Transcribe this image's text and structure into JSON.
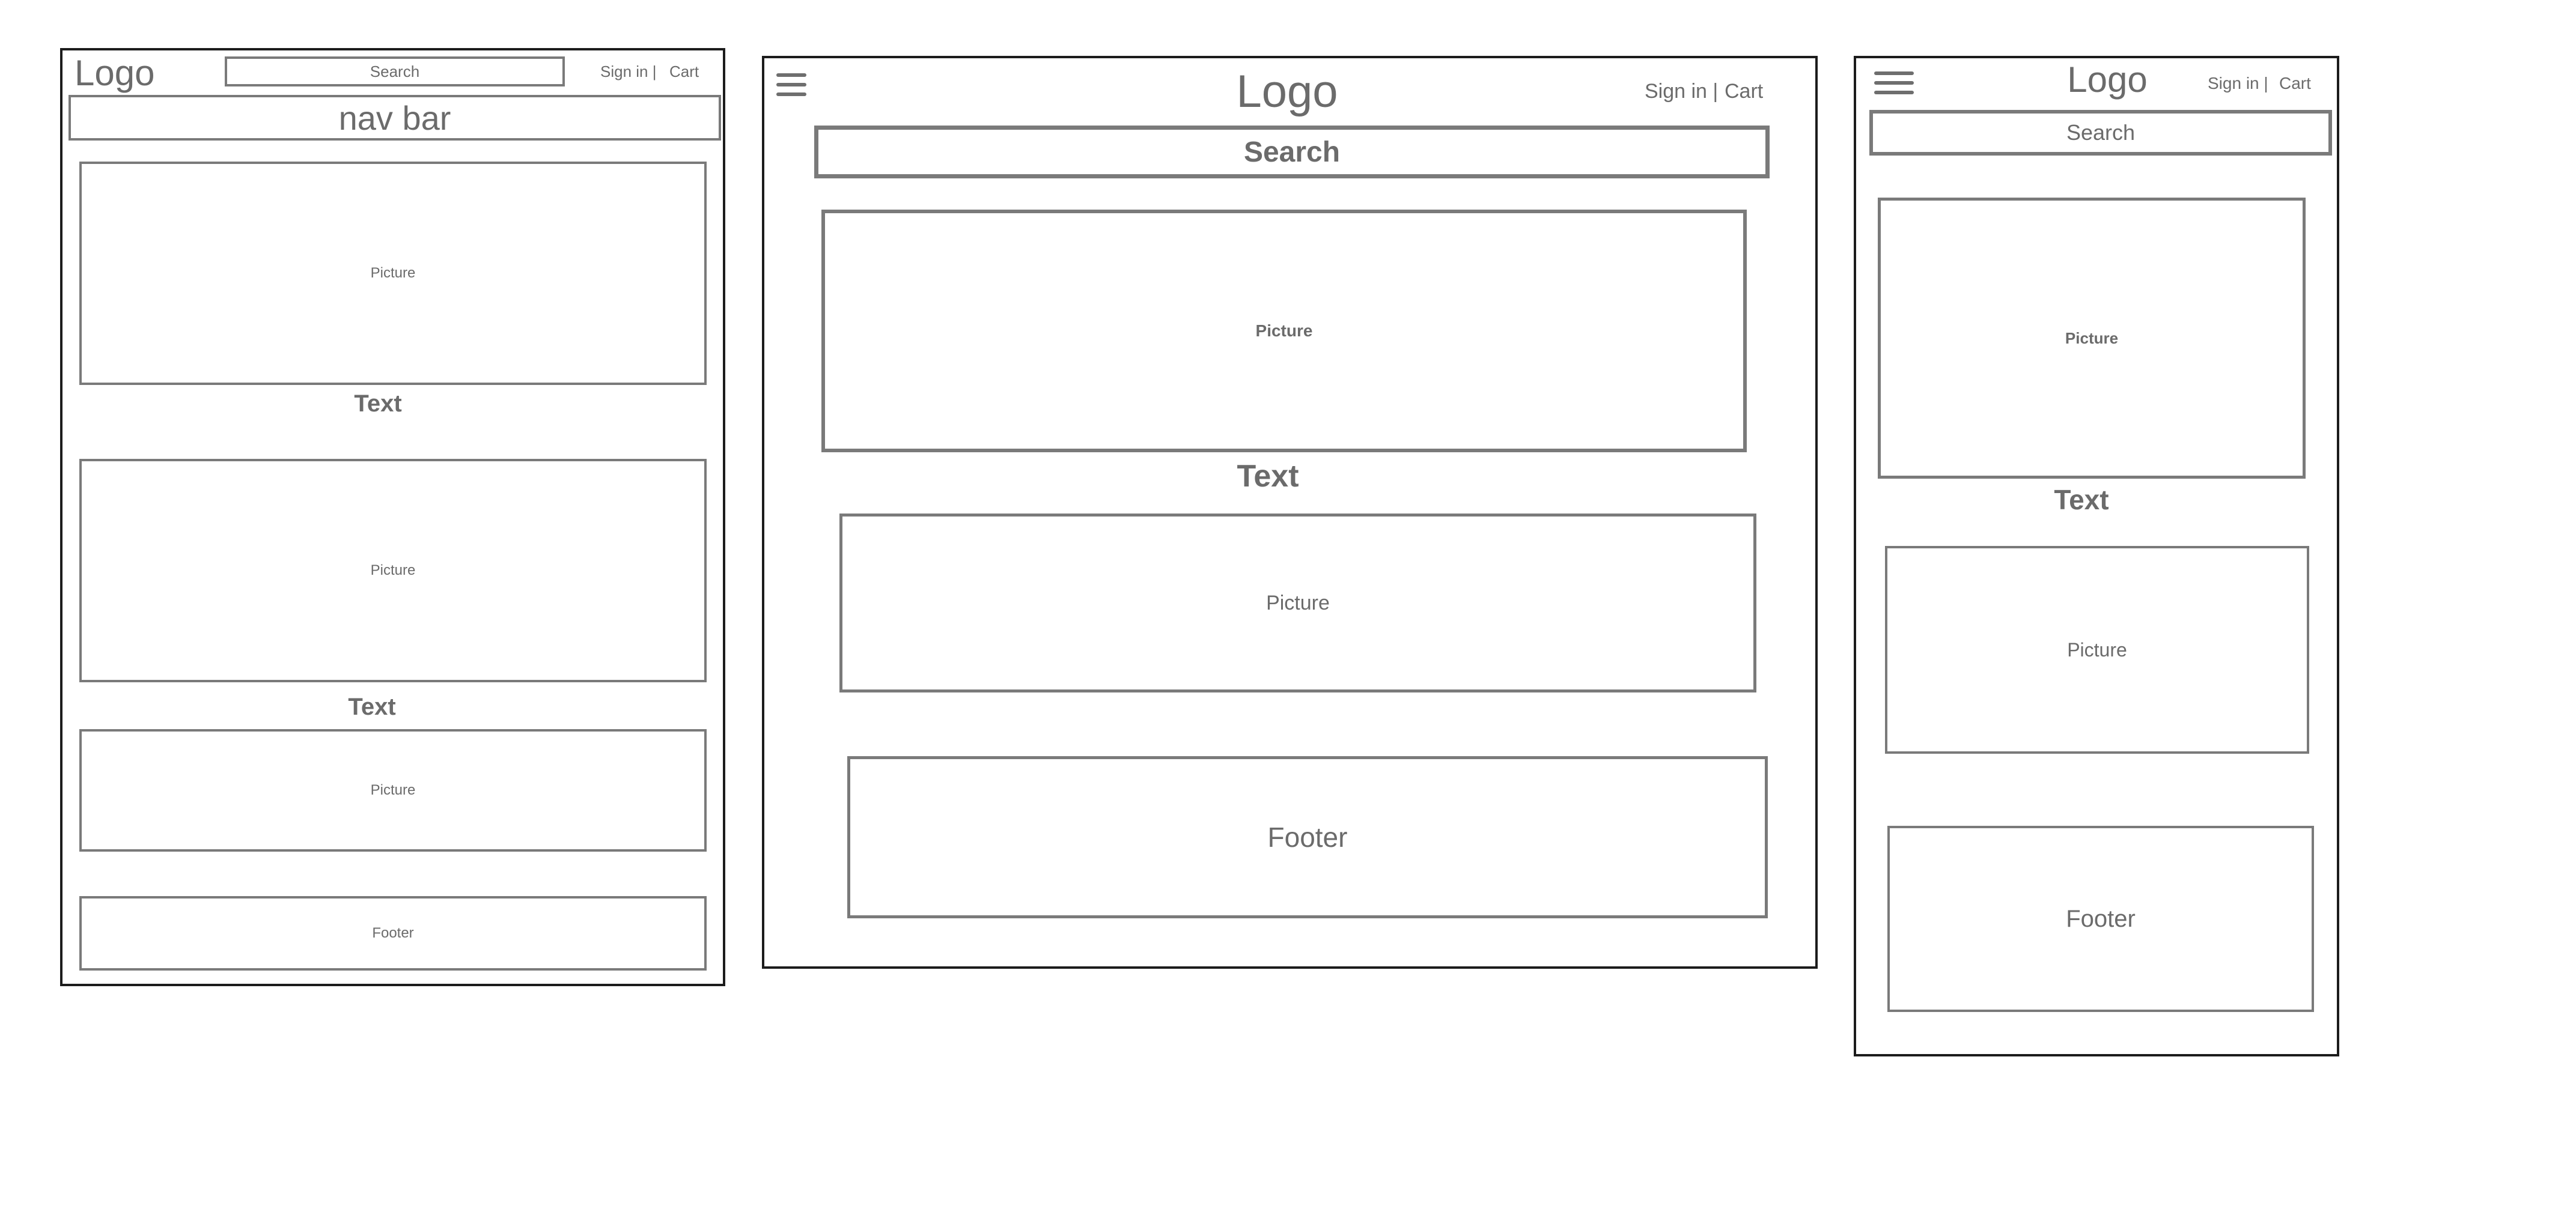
{
  "wireframes": {
    "desktop": {
      "logo": "Logo",
      "search": "Search",
      "sign_in": "Sign in |",
      "cart": "Cart",
      "nav_bar": "nav bar",
      "picture_1": "Picture",
      "text_1": "Text",
      "picture_2": "Picture",
      "text_2": "Text",
      "picture_3": "Picture",
      "footer": "Footer"
    },
    "tablet": {
      "menu_icon": "hamburger-menu-icon",
      "logo": "Logo",
      "sign_in": "Sign in |",
      "cart": "Cart",
      "search": "Search",
      "picture_1": "Picture",
      "text_1": "Text",
      "picture_2": "Picture",
      "footer": "Footer"
    },
    "mobile": {
      "menu_icon": "hamburger-menu-icon",
      "logo": "Logo",
      "sign_in": "Sign in |",
      "cart": "Cart",
      "search": "Search",
      "picture_1": "Picture",
      "text_1": "Text",
      "picture_2": "Picture",
      "footer": "Footer"
    }
  }
}
